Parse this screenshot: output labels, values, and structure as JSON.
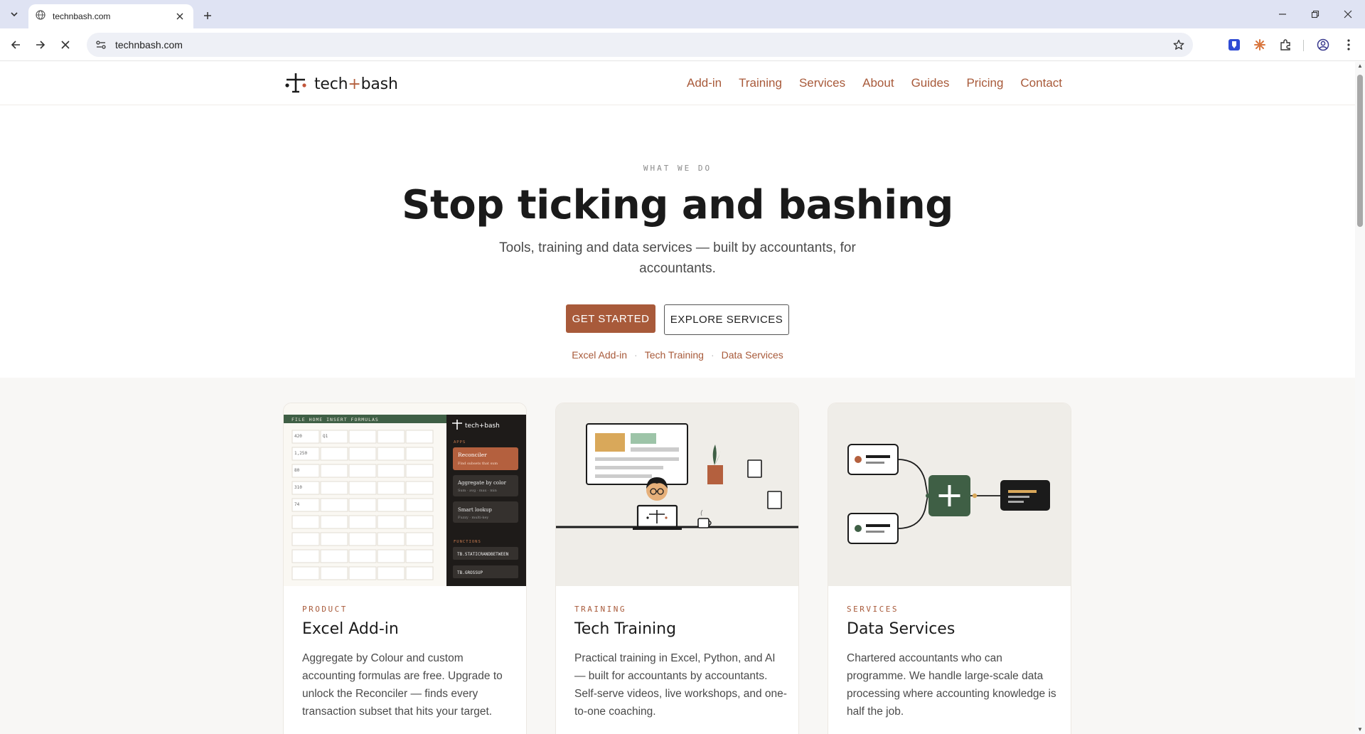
{
  "browser": {
    "tab_title": "technbash.com",
    "url": "technbash.com"
  },
  "site": {
    "logo_text_left": "tech",
    "logo_text_plus": "+",
    "logo_text_right": "bash",
    "nav": [
      "Add-in",
      "Training",
      "Services",
      "About",
      "Guides",
      "Pricing",
      "Contact"
    ]
  },
  "hero": {
    "eyebrow": "WHAT WE DO",
    "title": "Stop ticking and bashing",
    "subtitle": "Tools, training and data services — built by accountants, for accountants.",
    "primary_button": "GET STARTED",
    "secondary_button": "EXPLORE SERVICES",
    "quick_links": [
      "Excel Add-in",
      "Tech Training",
      "Data Services"
    ],
    "separator": "·"
  },
  "cards": [
    {
      "tag": "PRODUCT",
      "title": "Excel Add-in",
      "body": "Aggregate by Colour and custom accounting formulas are free. Upgrade to unlock the Reconciler — finds every transaction subset that hits your target."
    },
    {
      "tag": "TRAINING",
      "title": "Tech Training",
      "body": "Practical training in Excel, Python, and AI — built for accountants by accountants. Self-serve videos, live workshops, and one-to-one coaching."
    },
    {
      "tag": "SERVICES",
      "title": "Data Services",
      "body": "Chartered accountants who can programme. We handle large-scale data processing where accounting knowledge is half the job."
    }
  ],
  "addin_mock": {
    "menu": "FILE  HOME  INSERT  FORMULAS",
    "brand": "tech+bash",
    "apps_label": "APPS",
    "functions_label": "FUNCTIONS",
    "cells": [
      "420",
      "Q1",
      "1,250",
      "80",
      "310",
      "74"
    ],
    "app1_title": "Reconciler",
    "app1_sub": "Find subsets that sum",
    "app2_title": "Aggregate by color",
    "app2_sub": "Sum · avg · max · min",
    "app3_title": "Smart lookup",
    "app3_sub": "Fuzzy · multi-key",
    "func1": "TB.STATICRANDBETWEEN",
    "func2": "TB.GROSSUP"
  },
  "colors": {
    "accent": "#a85a3a",
    "dark_green": "#3f5f45",
    "section_bg": "#f8f7f5"
  }
}
